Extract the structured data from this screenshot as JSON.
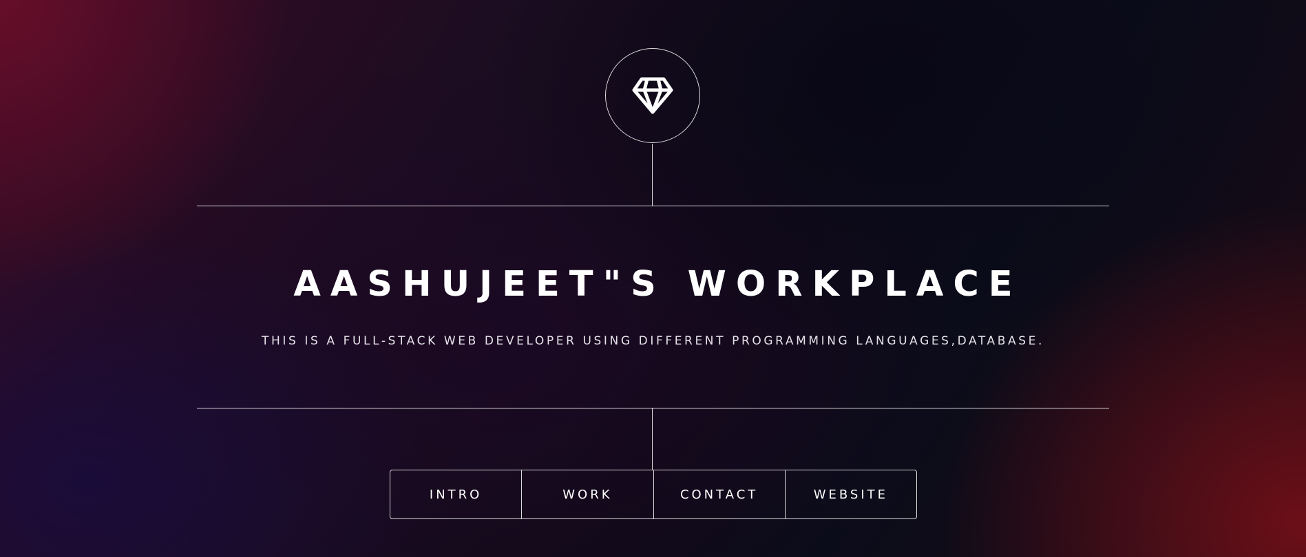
{
  "header": {
    "logo_icon": "diamond-icon",
    "title": "AASHUJEET\"S WORKPLACE",
    "subtitle": "THIS IS A FULL-STACK WEB DEVELOPER USING DIFFERENT PROGRAMMING LANGUAGES,DATABASE."
  },
  "nav": {
    "items": [
      {
        "label": "INTRO"
      },
      {
        "label": "WORK"
      },
      {
        "label": "CONTACT"
      },
      {
        "label": "WEBSITE"
      }
    ]
  },
  "colors": {
    "text": "#ffffff",
    "line": "#ffffff",
    "background_dark": "#150c1c",
    "accent_red": "#7a1018"
  }
}
